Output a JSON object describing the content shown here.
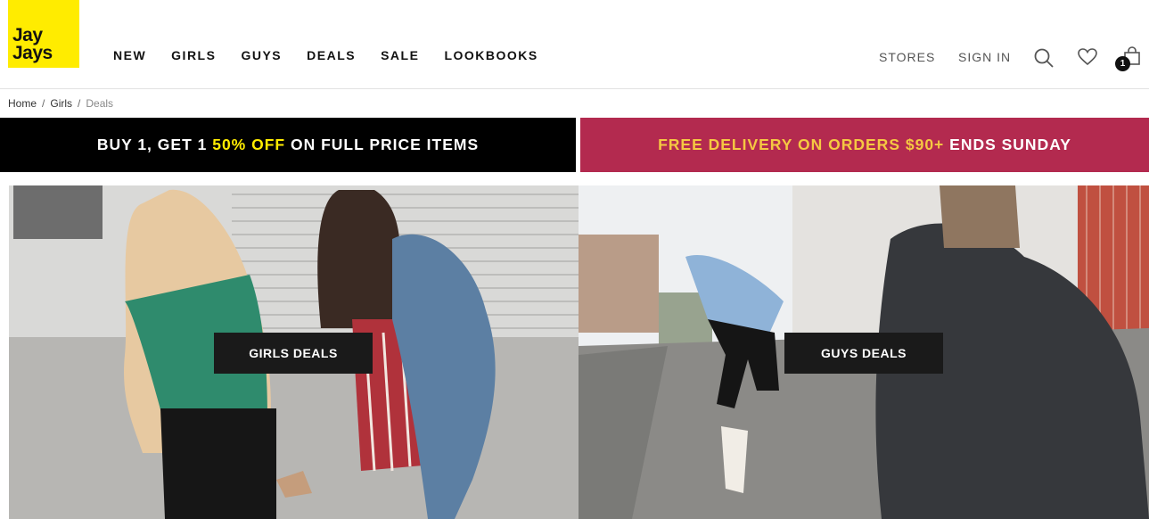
{
  "brand": {
    "line1": "Jay",
    "line2": "Jays",
    "color": "#ffec00"
  },
  "nav": [
    "NEW",
    "GIRLS",
    "GUYS",
    "DEALS",
    "SALE",
    "LOOKBOOKS"
  ],
  "account": {
    "stores": "STORES",
    "sign_in": "SIGN IN",
    "cart_count": "1"
  },
  "icons": {
    "search": "search-icon",
    "wishlist": "heart-icon",
    "cart": "bag-icon"
  },
  "breadcrumb": {
    "home": "Home",
    "sep": "/",
    "girls": "Girls",
    "current": "Deals"
  },
  "promos": {
    "left": {
      "pre": "BUY 1, GET 1 ",
      "highlight": "50% OFF",
      "post": " ON FULL PRICE ITEMS"
    },
    "right": {
      "highlight": "FREE DELIVERY ON ORDERS $90+",
      "post": " ENDS SUNDAY"
    }
  },
  "colors": {
    "promo_right_bg": "#b32a4f",
    "promo_left_bg": "#000000",
    "highlight": "#ffec00"
  },
  "tiles": {
    "girls": {
      "label": "GIRLS DEALS"
    },
    "guys": {
      "label": "GUYS DEALS"
    }
  }
}
